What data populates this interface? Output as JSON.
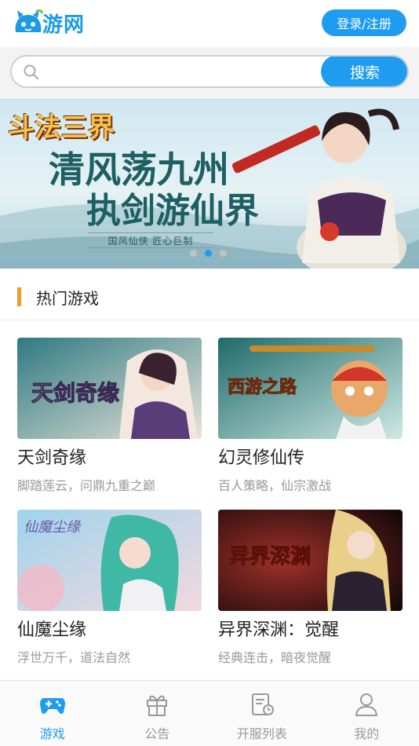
{
  "header": {
    "logo_text": "游网",
    "login_label": "登录/注册"
  },
  "search": {
    "placeholder": "",
    "button_label": "搜索"
  },
  "banner": {
    "game_logo": "斗法三界",
    "line1": "清风荡九州",
    "line2": "执剑游仙界",
    "slogan": "国风仙侠 匠心巨制",
    "slides": 3,
    "active_slide": 2
  },
  "section": {
    "title": "热门游戏"
  },
  "games": [
    {
      "title": "天剑奇缘",
      "desc": "脚踏莲云，问鼎九重之巅",
      "art_text": "天剑奇缘"
    },
    {
      "title": "幻灵修仙传",
      "desc": "百人策略，仙宗激战",
      "art_text": "西游之路"
    },
    {
      "title": "仙魔尘缘",
      "desc": "浮世万千，道法自然",
      "art_text": "仙魔尘缘"
    },
    {
      "title": "异界深渊：觉醒",
      "desc": "经典连击，暗夜觉醒",
      "art_text": "异界深渊"
    }
  ],
  "tabbar": {
    "items": [
      {
        "label": "游戏",
        "icon": "gamepad-icon",
        "active": true
      },
      {
        "label": "公告",
        "icon": "gift-icon",
        "active": false
      },
      {
        "label": "开服列表",
        "icon": "server-list-icon",
        "active": false
      },
      {
        "label": "我的",
        "icon": "user-icon",
        "active": false
      }
    ]
  },
  "colors": {
    "accent": "#1f9cf0",
    "section_bar": "#f09a2a"
  }
}
